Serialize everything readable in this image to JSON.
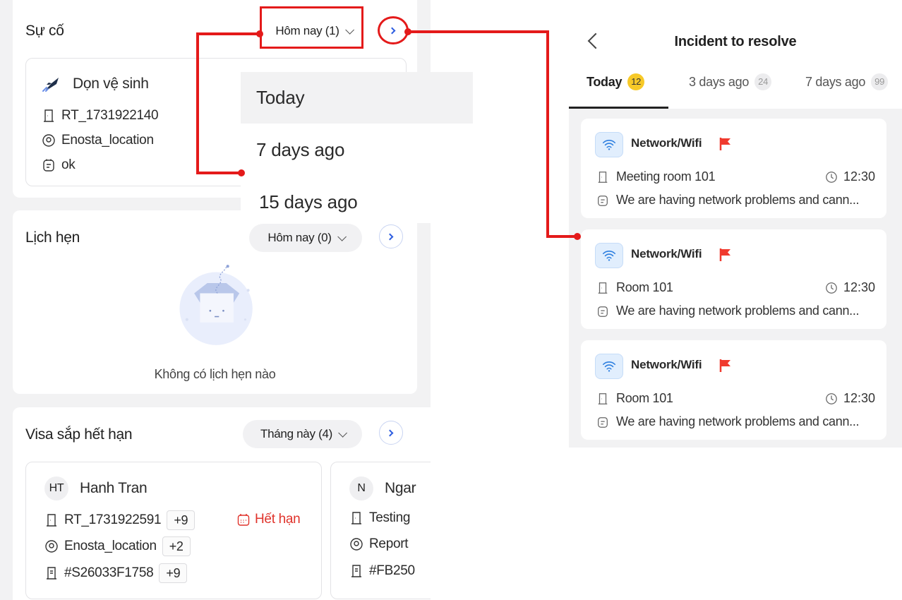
{
  "left": {
    "incidents": {
      "title": "Sự cố",
      "filter_label": "Hôm nay (1)",
      "card": {
        "title": "Dọn vệ sinh",
        "room": "RT_1731922140",
        "location": "Enosta_location",
        "note": "ok"
      }
    },
    "dropdown": {
      "options": [
        "Today",
        "7 days ago",
        "15 days ago"
      ],
      "selected": "Today"
    },
    "appointments": {
      "title": "Lịch hẹn",
      "filter_label": "Hôm nay (0)",
      "empty_text": "Không có lịch hẹn nào"
    },
    "visas": {
      "title": "Visa sắp hết hạn",
      "filter_label": "Tháng này (4)",
      "cards": [
        {
          "initials": "HT",
          "name": "Hanh Tran",
          "room": "RT_1731922591",
          "room_more": "+9",
          "status": "Hết hạn",
          "location": "Enosta_location",
          "location_more": "+2",
          "code": "#S26033F1758",
          "code_more": "+9"
        },
        {
          "initials": "N",
          "name": "Ngar",
          "room": "Testing",
          "location": "Report",
          "code": "#FB250"
        }
      ]
    }
  },
  "right": {
    "title": "Incident to resolve",
    "tabs": [
      {
        "label": "Today",
        "count": "12"
      },
      {
        "label": "3 days ago",
        "count": "24"
      },
      {
        "label": "7 days ago",
        "count": "99"
      }
    ],
    "incidents": [
      {
        "category": "Network/Wifi",
        "room": "Meeting room 101",
        "time": "12:30",
        "description": "We are having network problems and cann..."
      },
      {
        "category": "Network/Wifi",
        "room": "Room 101",
        "time": "12:30",
        "description": "We are having network problems and cann..."
      },
      {
        "category": "Network/Wifi",
        "room": "Room 101",
        "time": "12:30",
        "description": "We are having network problems and cann..."
      }
    ]
  },
  "colors": {
    "annotation_red": "#e41a1a",
    "accent_blue": "#2d5de0",
    "expired_red": "#e0332b",
    "today_badge": "#f7c928",
    "flag_red": "#f03a2e"
  }
}
